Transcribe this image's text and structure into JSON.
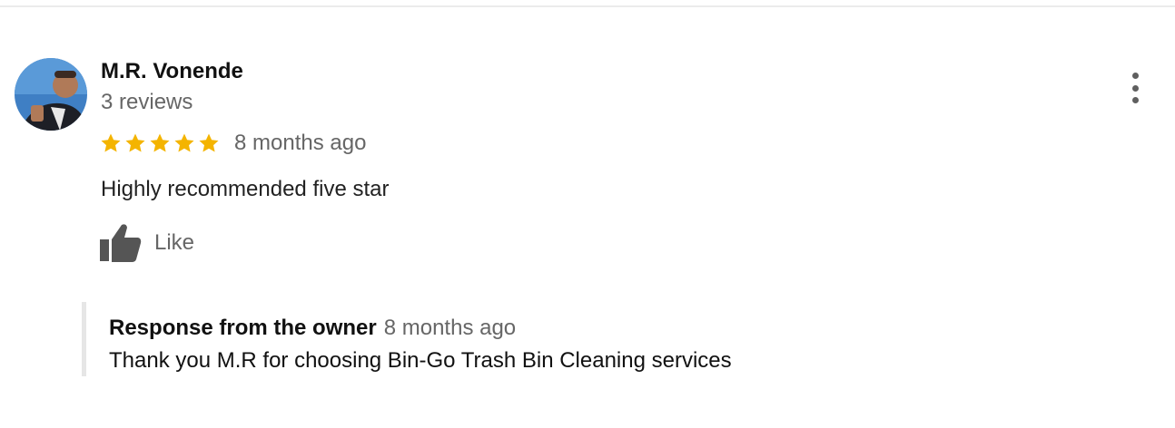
{
  "review": {
    "author_name": "M.R. Vonende",
    "review_count": "3 reviews",
    "rating": 5,
    "rating_max": 5,
    "star_color": "#f4b400",
    "time": "8 months ago",
    "text": "Highly recommended five star",
    "like_label": "Like",
    "avatar_icon": "user-photo",
    "like_icon": "thumbs-up-icon",
    "menu_icon": "more-vertical-icon"
  },
  "owner_response": {
    "title": "Response from the owner",
    "time": "8 months ago",
    "text": "Thank you M.R for choosing Bin-Go Trash Bin Cleaning services"
  }
}
